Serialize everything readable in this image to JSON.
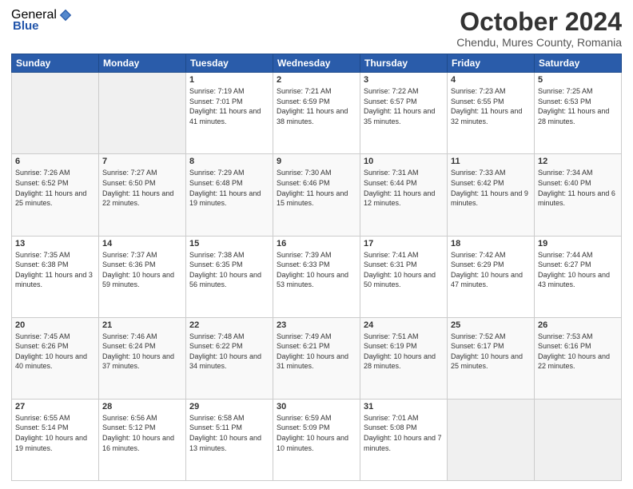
{
  "logo": {
    "general": "General",
    "blue": "Blue"
  },
  "title": "October 2024",
  "subtitle": "Chendu, Mures County, Romania",
  "weekdays": [
    "Sunday",
    "Monday",
    "Tuesday",
    "Wednesday",
    "Thursday",
    "Friday",
    "Saturday"
  ],
  "weeks": [
    [
      {
        "day": "",
        "info": ""
      },
      {
        "day": "",
        "info": ""
      },
      {
        "day": "1",
        "info": "Sunrise: 7:19 AM\nSunset: 7:01 PM\nDaylight: 11 hours and 41 minutes."
      },
      {
        "day": "2",
        "info": "Sunrise: 7:21 AM\nSunset: 6:59 PM\nDaylight: 11 hours and 38 minutes."
      },
      {
        "day": "3",
        "info": "Sunrise: 7:22 AM\nSunset: 6:57 PM\nDaylight: 11 hours and 35 minutes."
      },
      {
        "day": "4",
        "info": "Sunrise: 7:23 AM\nSunset: 6:55 PM\nDaylight: 11 hours and 32 minutes."
      },
      {
        "day": "5",
        "info": "Sunrise: 7:25 AM\nSunset: 6:53 PM\nDaylight: 11 hours and 28 minutes."
      }
    ],
    [
      {
        "day": "6",
        "info": "Sunrise: 7:26 AM\nSunset: 6:52 PM\nDaylight: 11 hours and 25 minutes."
      },
      {
        "day": "7",
        "info": "Sunrise: 7:27 AM\nSunset: 6:50 PM\nDaylight: 11 hours and 22 minutes."
      },
      {
        "day": "8",
        "info": "Sunrise: 7:29 AM\nSunset: 6:48 PM\nDaylight: 11 hours and 19 minutes."
      },
      {
        "day": "9",
        "info": "Sunrise: 7:30 AM\nSunset: 6:46 PM\nDaylight: 11 hours and 15 minutes."
      },
      {
        "day": "10",
        "info": "Sunrise: 7:31 AM\nSunset: 6:44 PM\nDaylight: 11 hours and 12 minutes."
      },
      {
        "day": "11",
        "info": "Sunrise: 7:33 AM\nSunset: 6:42 PM\nDaylight: 11 hours and 9 minutes."
      },
      {
        "day": "12",
        "info": "Sunrise: 7:34 AM\nSunset: 6:40 PM\nDaylight: 11 hours and 6 minutes."
      }
    ],
    [
      {
        "day": "13",
        "info": "Sunrise: 7:35 AM\nSunset: 6:38 PM\nDaylight: 11 hours and 3 minutes."
      },
      {
        "day": "14",
        "info": "Sunrise: 7:37 AM\nSunset: 6:36 PM\nDaylight: 10 hours and 59 minutes."
      },
      {
        "day": "15",
        "info": "Sunrise: 7:38 AM\nSunset: 6:35 PM\nDaylight: 10 hours and 56 minutes."
      },
      {
        "day": "16",
        "info": "Sunrise: 7:39 AM\nSunset: 6:33 PM\nDaylight: 10 hours and 53 minutes."
      },
      {
        "day": "17",
        "info": "Sunrise: 7:41 AM\nSunset: 6:31 PM\nDaylight: 10 hours and 50 minutes."
      },
      {
        "day": "18",
        "info": "Sunrise: 7:42 AM\nSunset: 6:29 PM\nDaylight: 10 hours and 47 minutes."
      },
      {
        "day": "19",
        "info": "Sunrise: 7:44 AM\nSunset: 6:27 PM\nDaylight: 10 hours and 43 minutes."
      }
    ],
    [
      {
        "day": "20",
        "info": "Sunrise: 7:45 AM\nSunset: 6:26 PM\nDaylight: 10 hours and 40 minutes."
      },
      {
        "day": "21",
        "info": "Sunrise: 7:46 AM\nSunset: 6:24 PM\nDaylight: 10 hours and 37 minutes."
      },
      {
        "day": "22",
        "info": "Sunrise: 7:48 AM\nSunset: 6:22 PM\nDaylight: 10 hours and 34 minutes."
      },
      {
        "day": "23",
        "info": "Sunrise: 7:49 AM\nSunset: 6:21 PM\nDaylight: 10 hours and 31 minutes."
      },
      {
        "day": "24",
        "info": "Sunrise: 7:51 AM\nSunset: 6:19 PM\nDaylight: 10 hours and 28 minutes."
      },
      {
        "day": "25",
        "info": "Sunrise: 7:52 AM\nSunset: 6:17 PM\nDaylight: 10 hours and 25 minutes."
      },
      {
        "day": "26",
        "info": "Sunrise: 7:53 AM\nSunset: 6:16 PM\nDaylight: 10 hours and 22 minutes."
      }
    ],
    [
      {
        "day": "27",
        "info": "Sunrise: 6:55 AM\nSunset: 5:14 PM\nDaylight: 10 hours and 19 minutes."
      },
      {
        "day": "28",
        "info": "Sunrise: 6:56 AM\nSunset: 5:12 PM\nDaylight: 10 hours and 16 minutes."
      },
      {
        "day": "29",
        "info": "Sunrise: 6:58 AM\nSunset: 5:11 PM\nDaylight: 10 hours and 13 minutes."
      },
      {
        "day": "30",
        "info": "Sunrise: 6:59 AM\nSunset: 5:09 PM\nDaylight: 10 hours and 10 minutes."
      },
      {
        "day": "31",
        "info": "Sunrise: 7:01 AM\nSunset: 5:08 PM\nDaylight: 10 hours and 7 minutes."
      },
      {
        "day": "",
        "info": ""
      },
      {
        "day": "",
        "info": ""
      }
    ]
  ]
}
